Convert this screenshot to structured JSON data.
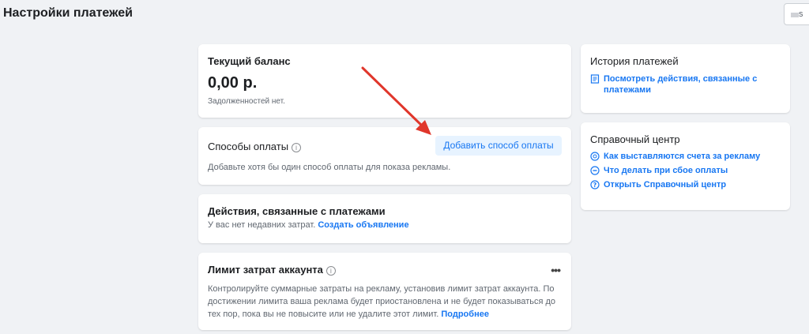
{
  "page": {
    "title": "Настройки платежей"
  },
  "top_button": {
    "label": "s"
  },
  "balance": {
    "title": "Текущий баланс",
    "amount": "0,00 р.",
    "note": "Задолженностей нет."
  },
  "payment_methods": {
    "title": "Способы оплаты",
    "add_button": "Добавить способ оплаты",
    "hint": "Добавьте хотя бы один способ оплаты для показа рекламы."
  },
  "payment_actions": {
    "title": "Действия, связанные с платежами",
    "text": "У вас нет недавних затрат.",
    "link": "Создать объявление"
  },
  "spend_limit": {
    "title": "Лимит затрат аккаунта",
    "more": "•••",
    "text": "Контролируйте суммарные затраты на рекламу, установив лимит затрат аккаунта. По достижении лимита ваша реклама будет приостановлена и не будет показываться до тех пор, пока вы не повысите или не удалите этот лимит.",
    "link": "Подробнее"
  },
  "history": {
    "title": "История платежей",
    "link": "Посмотреть действия, связанные с платежами"
  },
  "help_center": {
    "title": "Справочный центр",
    "links": [
      {
        "label": "Как выставляются счета за рекламу",
        "icon": "coins-icon"
      },
      {
        "label": "Что делать при сбое оплаты",
        "icon": "minus-circle-icon"
      },
      {
        "label": "Открыть Справочный центр",
        "icon": "question-circle-icon"
      }
    ]
  },
  "colors": {
    "accent": "#1877f2",
    "arrow": "#e0362b",
    "background": "#f0f2f5"
  }
}
